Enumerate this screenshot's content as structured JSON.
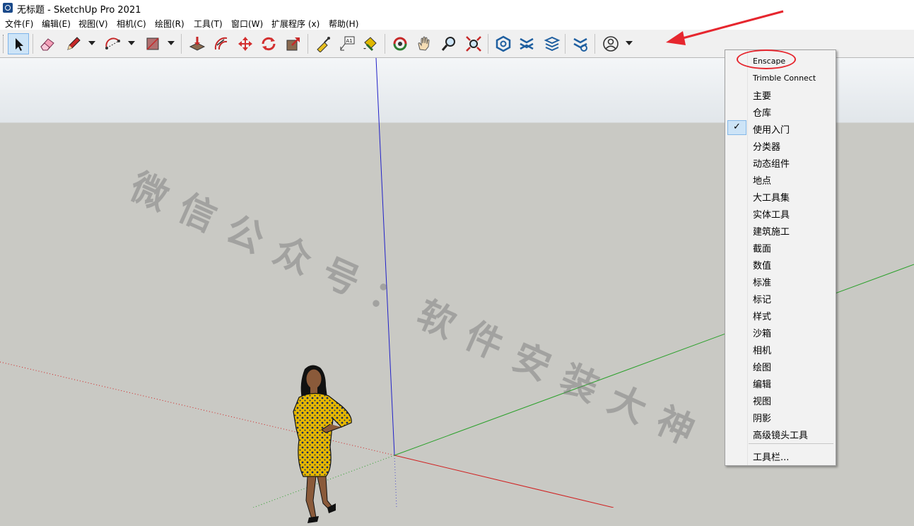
{
  "window": {
    "title": "无标题 - SketchUp Pro 2021"
  },
  "menubar": [
    "文件(F)",
    "编辑(E)",
    "视图(V)",
    "相机(C)",
    "绘图(R)",
    "工具(T)",
    "窗口(W)",
    "扩展程序 (x)",
    "帮助(H)"
  ],
  "toolbar": {
    "tools": [
      "select-tool-icon",
      "eraser-tool-icon",
      "pencil-tool-icon",
      "arc-tool-icon",
      "rectangle-tool-icon",
      "push-pull-tool-icon",
      "offset-tool-icon",
      "move-tool-icon",
      "rotate-tool-icon",
      "scale-tool-icon",
      "tape-measure-tool-icon",
      "text-tool-icon",
      "paint-bucket-tool-icon",
      "orbit-tool-icon",
      "pan-tool-icon",
      "zoom-tool-icon",
      "zoom-extents-tool-icon",
      "enscape-start-icon",
      "enscape-sync-icon",
      "enscape-views-icon",
      "enscape-settings-icon",
      "account-icon"
    ],
    "text_tool_label": "A1"
  },
  "viewport": {
    "watermark": "微信公众号：软件安装大神"
  },
  "context_menu": {
    "items": [
      {
        "label": "Enscape",
        "checked": false
      },
      {
        "label": "Trimble Connect",
        "checked": false
      },
      {
        "label": "主要",
        "checked": false
      },
      {
        "label": "仓库",
        "checked": false
      },
      {
        "label": "使用入门",
        "checked": true
      },
      {
        "label": "分类器",
        "checked": false
      },
      {
        "label": "动态组件",
        "checked": false
      },
      {
        "label": "地点",
        "checked": false
      },
      {
        "label": "大工具集",
        "checked": false
      },
      {
        "label": "实体工具",
        "checked": false
      },
      {
        "label": "建筑施工",
        "checked": false
      },
      {
        "label": "截面",
        "checked": false
      },
      {
        "label": "数值",
        "checked": false
      },
      {
        "label": "标准",
        "checked": false
      },
      {
        "label": "标记",
        "checked": false
      },
      {
        "label": "样式",
        "checked": false
      },
      {
        "label": "沙箱",
        "checked": false
      },
      {
        "label": "相机",
        "checked": false
      },
      {
        "label": "绘图",
        "checked": false
      },
      {
        "label": "编辑",
        "checked": false
      },
      {
        "label": "视图",
        "checked": false
      },
      {
        "label": "阴影",
        "checked": false
      },
      {
        "label": "高级镜头工具",
        "checked": false
      }
    ],
    "footer": "工具栏...",
    "check_mark": "✓"
  },
  "colors": {
    "annotation_red": "#e6262e",
    "axis_red": "#d02020",
    "axis_green": "#2aa02a",
    "axis_blue": "#2020c8",
    "selection_blue": "#cde4f7"
  }
}
